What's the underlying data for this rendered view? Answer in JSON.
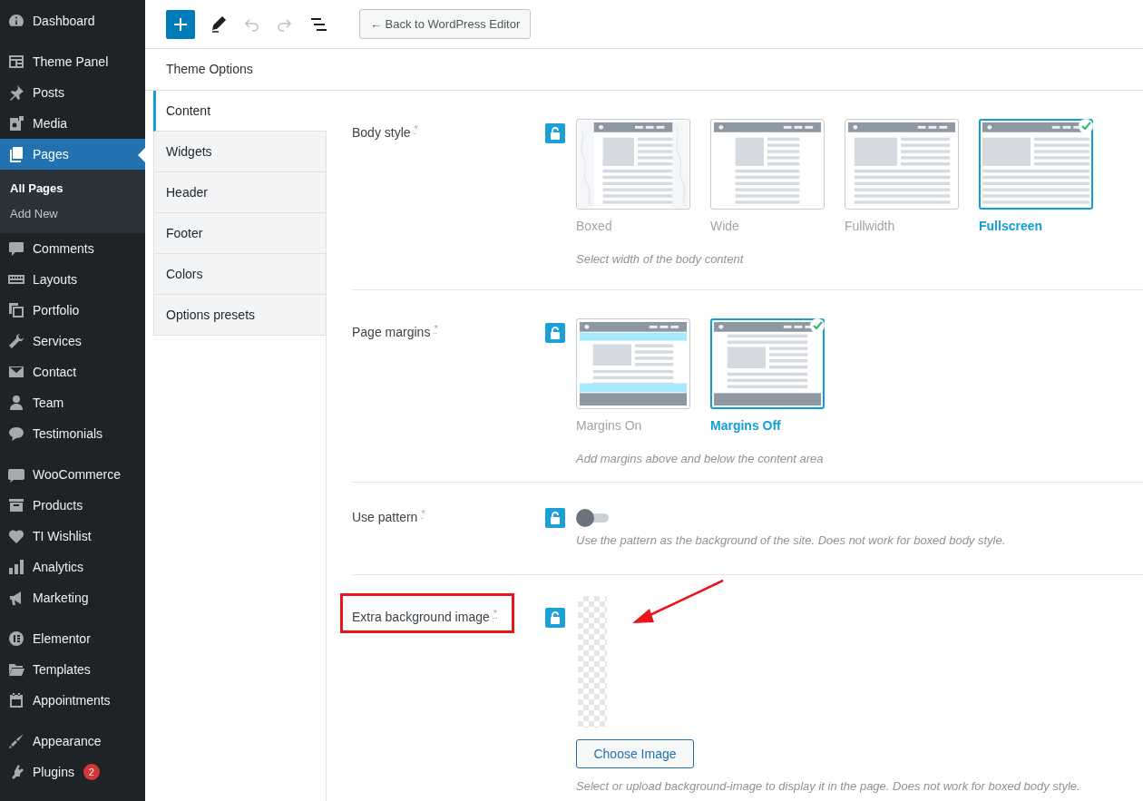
{
  "sidebar": {
    "groups": [
      [
        {
          "label": "Dashboard",
          "selected": false
        }
      ],
      [
        {
          "label": "Theme Panel",
          "selected": false
        },
        {
          "label": "Posts",
          "selected": false
        },
        {
          "label": "Media",
          "selected": false
        },
        {
          "label": "Pages",
          "selected": true,
          "submenu": [
            {
              "label": "All Pages",
              "selected": true
            },
            {
              "label": "Add New",
              "selected": false
            }
          ]
        },
        {
          "label": "Comments",
          "selected": false
        },
        {
          "label": "Layouts",
          "selected": false
        },
        {
          "label": "Portfolio",
          "selected": false
        },
        {
          "label": "Services",
          "selected": false
        },
        {
          "label": "Contact",
          "selected": false
        },
        {
          "label": "Team",
          "selected": false
        },
        {
          "label": "Testimonials",
          "selected": false
        }
      ],
      [
        {
          "label": "WooCommerce",
          "selected": false
        },
        {
          "label": "Products",
          "selected": false
        },
        {
          "label": "TI Wishlist",
          "selected": false
        },
        {
          "label": "Analytics",
          "selected": false
        },
        {
          "label": "Marketing",
          "selected": false
        }
      ],
      [
        {
          "label": "Elementor",
          "selected": false
        },
        {
          "label": "Templates",
          "selected": false
        },
        {
          "label": "Appointments",
          "selected": false
        }
      ],
      [
        {
          "label": "Appearance",
          "selected": false
        },
        {
          "label": "Plugins",
          "selected": false,
          "badge": "2"
        }
      ]
    ]
  },
  "toolbar": {
    "tools": [
      {
        "kind": "add",
        "disabled": false
      },
      {
        "kind": "edit",
        "disabled": false
      },
      {
        "kind": "undo",
        "disabled": true
      },
      {
        "kind": "redo",
        "disabled": true
      },
      {
        "kind": "list",
        "disabled": false
      }
    ],
    "back_button": "← Back to WordPress Editor"
  },
  "page_title": "Theme Options",
  "tabs": [
    {
      "label": "Content",
      "selected": true
    },
    {
      "label": "Widgets",
      "selected": false
    },
    {
      "label": "Header",
      "selected": false
    },
    {
      "label": "Footer",
      "selected": false
    },
    {
      "label": "Colors",
      "selected": false
    },
    {
      "label": "Options presets",
      "selected": false
    }
  ],
  "settings": [
    {
      "kind": "image_choice",
      "label": "Body style",
      "mark": "*",
      "options": [
        {
          "label": "Boxed",
          "selected": false
        },
        {
          "label": "Wide",
          "selected": false
        },
        {
          "label": "Fullwidth",
          "selected": false
        },
        {
          "label": "Fullscreen",
          "selected": true
        }
      ],
      "hint": "Select width of the body content"
    },
    {
      "kind": "image_choice",
      "label": "Page margins",
      "mark": "*",
      "options": [
        {
          "label": "Margins On",
          "selected": false
        },
        {
          "label": "Margins Off",
          "selected": true
        }
      ],
      "hint": "Add margins above and below the content area"
    },
    {
      "kind": "toggle",
      "label": "Use pattern",
      "mark": "*",
      "on": false,
      "hint": "Use the pattern as the background of the site. Does not work for boxed body style."
    },
    {
      "kind": "image_upload",
      "label": "Extra background image",
      "mark": "*",
      "button": "Choose Image",
      "hint": "Select or upload background-image to display it in the page. Does not work for boxed body style."
    }
  ]
}
